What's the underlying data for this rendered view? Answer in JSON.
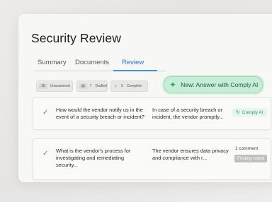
{
  "page": {
    "title": "Security Review"
  },
  "tabs": [
    {
      "label": "Summary"
    },
    {
      "label": "Documents"
    },
    {
      "label": "Review"
    }
  ],
  "filters": {
    "unanswered": {
      "count": "16",
      "label": "Unanswered"
    },
    "drafted": {
      "count": "7",
      "label": "Drafted"
    },
    "complete": {
      "count": "9",
      "label": "Complete"
    }
  },
  "actions": {
    "new_answer": "New: Answer with Comply AI"
  },
  "rows": [
    {
      "question": "How would the vendor notify us in the event of a security breach or incident?",
      "answer": "In case of a security breach or incident, the vendor promptly...",
      "tag": "Comply AI"
    },
    {
      "question": "What is the vendor's process for investigating and remediating security...",
      "answer": "The vendor ensures data privacy and compliance with r...",
      "comment": "1 comment",
      "status": "Finding noted"
    }
  ],
  "colors": {
    "accent": "#2b6fd6",
    "success": "#3aa56d",
    "ai_bg": "#c7ecd7"
  }
}
